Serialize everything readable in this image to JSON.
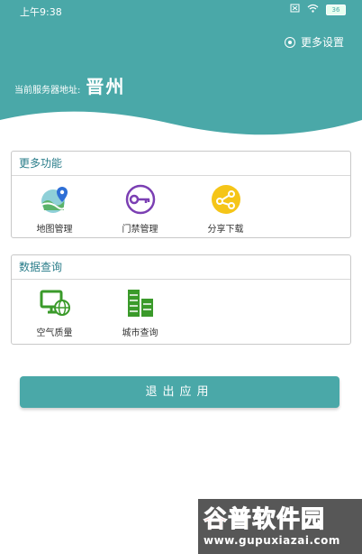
{
  "status_bar": {
    "time": "上午9:38",
    "battery": "36"
  },
  "header": {
    "more_settings": "更多设置",
    "server_label": "当前服务器地址:",
    "server_value": "晋州"
  },
  "more_functions": {
    "title": "更多功能",
    "items": [
      {
        "label": "地图管理",
        "icon": "map-icon"
      },
      {
        "label": "门禁管理",
        "icon": "key-icon"
      },
      {
        "label": "分享下载",
        "icon": "share-icon"
      }
    ]
  },
  "data_query": {
    "title": "数据查询",
    "items": [
      {
        "label": "空气质量",
        "icon": "monitor-globe-icon"
      },
      {
        "label": "城市查询",
        "icon": "buildings-icon"
      }
    ]
  },
  "exit_button": "退出应用",
  "watermark": {
    "brand_part1": "谷",
    "brand_part2": "普",
    "brand_part3": "软件园",
    "url": "www.gupuxiazai.com"
  },
  "colors": {
    "primary": "#4aa8a8",
    "title_text": "#2a7d8a"
  }
}
